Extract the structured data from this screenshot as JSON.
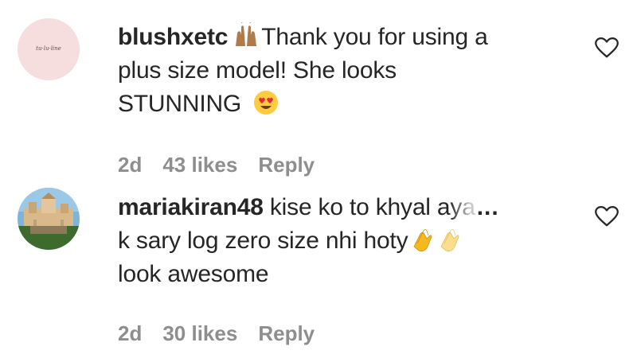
{
  "comments": [
    {
      "username": "blushxetc",
      "avatar_logo_text": "tu·lu·line",
      "text_lines": [
        "Thank you for using a",
        "plus size model! She looks",
        "STUNNING"
      ],
      "emojis": [
        "raising-hands-emoji",
        "heart-eyes-emoji"
      ],
      "time": "2d",
      "likes": "43 likes",
      "reply_label": "Reply"
    },
    {
      "username": "mariakiran48",
      "text_line1": "kise ko to khyal a",
      "text_faded": "ya",
      "ellipsis": "...",
      "text_line2": "k sary log zero size nhi hoty",
      "text_line3": "look awesome",
      "emojis": [
        "clapping-hands-emoji",
        "clapping-hands-emoji"
      ],
      "time": "2d",
      "likes": "30 likes",
      "reply_label": "Reply"
    }
  ],
  "colors": {
    "text": "#262626",
    "meta": "#8e8e8e",
    "avatar1_bg": "#f6dede"
  }
}
